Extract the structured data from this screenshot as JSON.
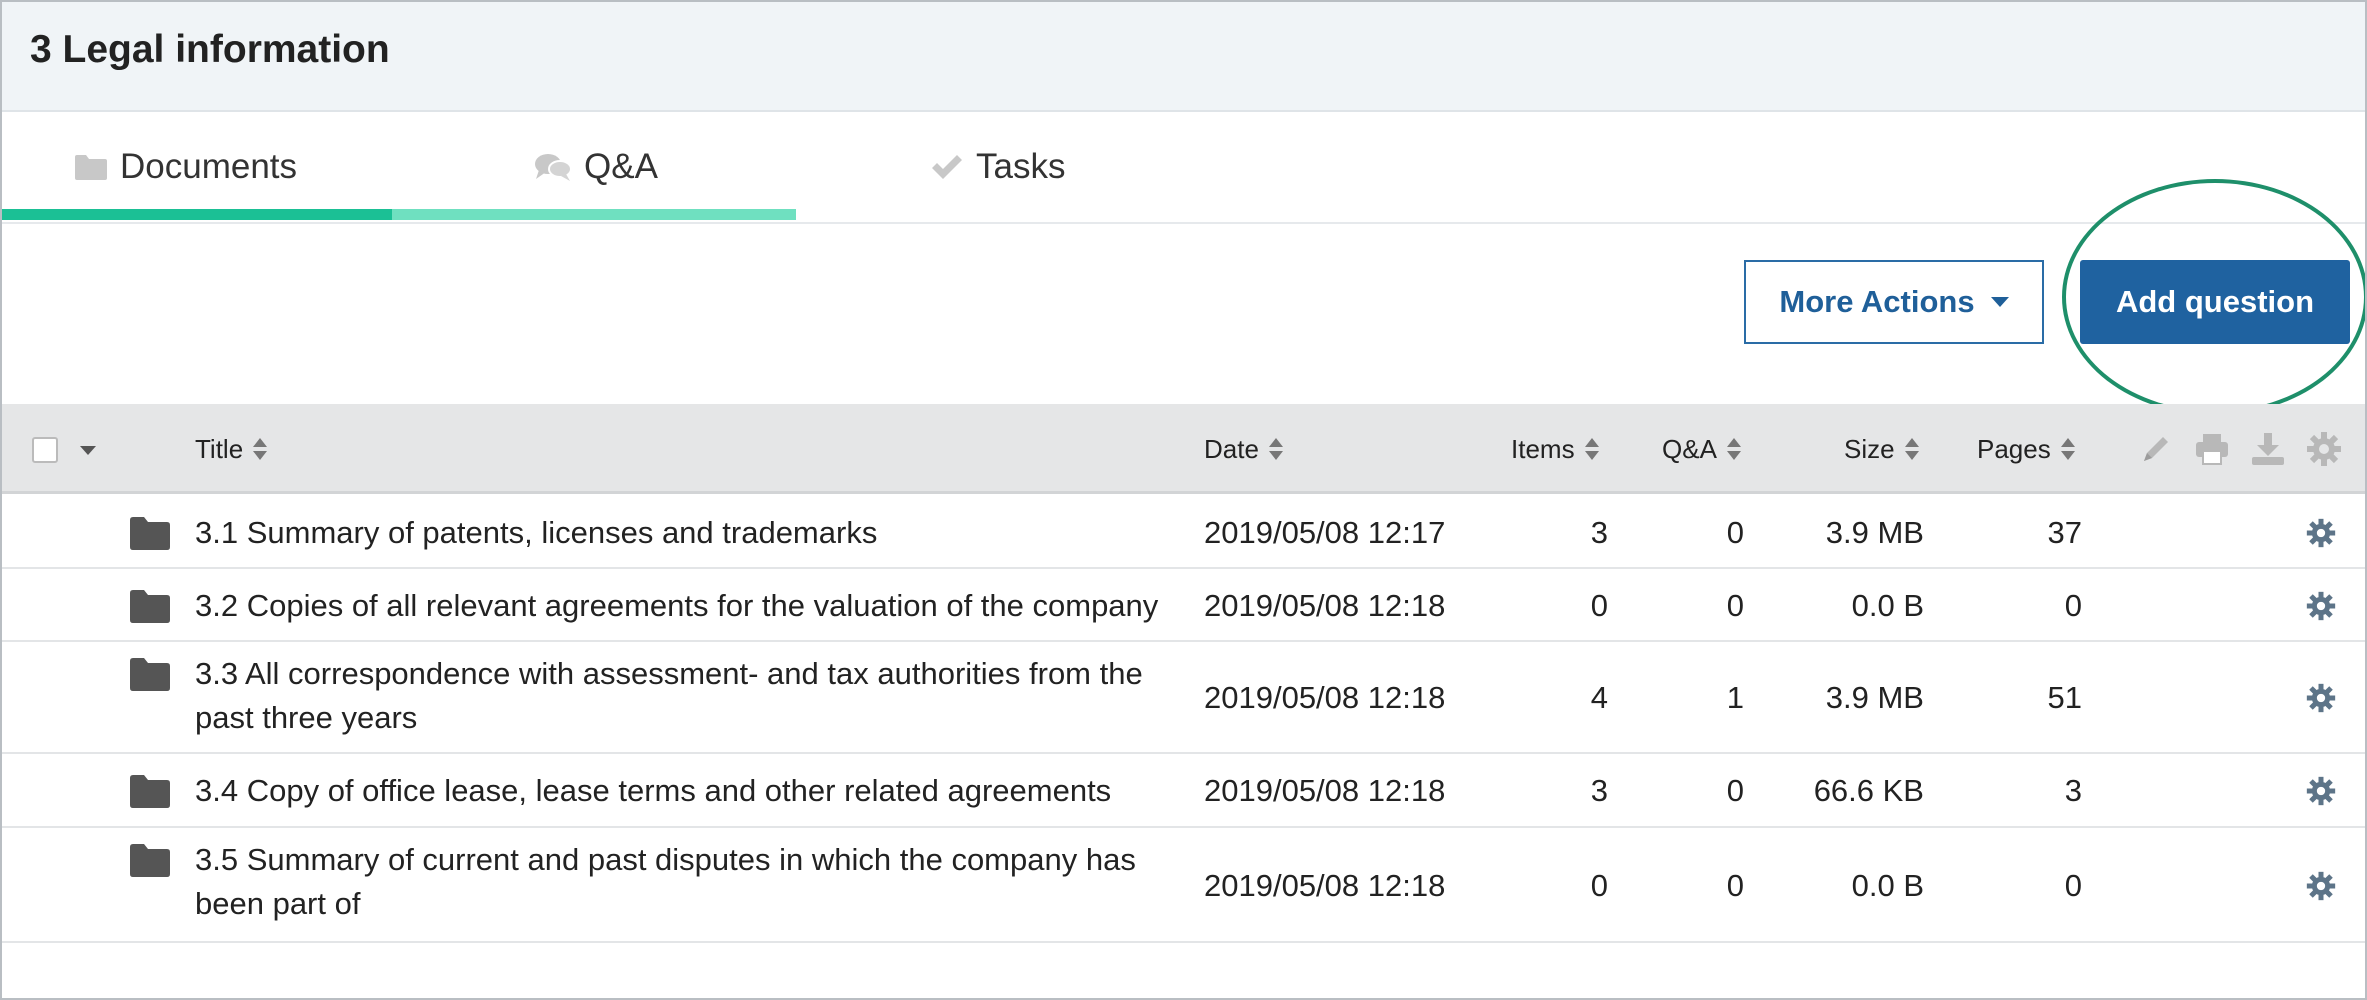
{
  "header": {
    "title": "3 Legal information"
  },
  "tabs": [
    {
      "label": "Documents",
      "icon": "folder-icon"
    },
    {
      "label": "Q&A",
      "icon": "comments-icon"
    },
    {
      "label": "Tasks",
      "icon": "check-icon"
    }
  ],
  "toolbar": {
    "more_actions_label": "More Actions",
    "add_question_label": "Add question"
  },
  "table": {
    "columns": {
      "title": "Title",
      "date": "Date",
      "items": "Items",
      "qa": "Q&A",
      "size": "Size",
      "pages": "Pages"
    },
    "header_icons": [
      "pencil-icon",
      "print-icon",
      "download-icon",
      "gear-icon"
    ],
    "rows": [
      {
        "title": "3.1 Summary of patents, licenses and trademarks",
        "date": "2019/05/08 12:17",
        "items": "3",
        "qa": "0",
        "size": "3.9 MB",
        "pages": "37"
      },
      {
        "title": "3.2 Copies of all relevant agreements for the valuation of the company",
        "date": "2019/05/08 12:18",
        "items": "0",
        "qa": "0",
        "size": "0.0 B",
        "pages": "0"
      },
      {
        "title": "3.3 All correspondence with assessment- and tax authorities from the past three years",
        "date": "2019/05/08 12:18",
        "items": "4",
        "qa": "1",
        "size": "3.9 MB",
        "pages": "51"
      },
      {
        "title": "3.4 Copy of office lease, lease terms and other related agreements",
        "date": "2019/05/08 12:18",
        "items": "3",
        "qa": "0",
        "size": "66.6 KB",
        "pages": "3"
      },
      {
        "title": "3.5 Summary of current and past disputes in which the company has been part of",
        "date": "2019/05/08 12:18",
        "items": "0",
        "qa": "0",
        "size": "0.0 B",
        "pages": "0"
      }
    ]
  },
  "colors": {
    "accent": "#1bc095",
    "accent_light": "#6fe0c0",
    "primary": "#1f62a0",
    "highlight": "#1e8f6a"
  }
}
